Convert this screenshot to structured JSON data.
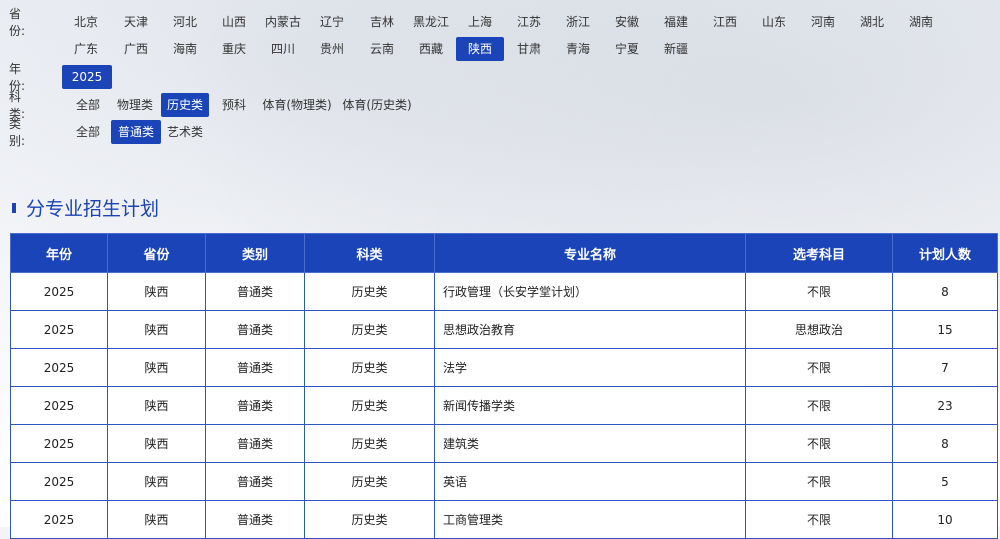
{
  "filters": {
    "province": {
      "label": "省份:",
      "row1": [
        "北京",
        "天津",
        "河北",
        "山西",
        "内蒙古",
        "辽宁",
        "吉林",
        "黑龙江",
        "上海",
        "江苏",
        "浙江",
        "安徽",
        "福建",
        "江西",
        "山东",
        "河南",
        "湖北",
        "湖南"
      ],
      "row2": [
        "广东",
        "广西",
        "海南",
        "重庆",
        "四川",
        "贵州",
        "云南",
        "西藏",
        "陕西",
        "甘肃",
        "青海",
        "宁夏",
        "新疆"
      ],
      "selected": "陕西"
    },
    "year": {
      "label": "年份:",
      "options": [
        "2025"
      ],
      "selected": "2025"
    },
    "subject": {
      "label": "科类:",
      "options": [
        "全部",
        "物理类",
        "历史类",
        "预科",
        "体育(物理类)",
        "体育(历史类)"
      ],
      "selected": "历史类"
    },
    "category": {
      "label": "类别:",
      "options": [
        "全部",
        "普通类",
        "艺术类"
      ],
      "selected": "普通类"
    }
  },
  "section": {
    "title": "分专业招生计划"
  },
  "table": {
    "headers": [
      "年份",
      "省份",
      "类别",
      "科类",
      "专业名称",
      "选考科目",
      "计划人数"
    ],
    "rows": [
      [
        "2025",
        "陕西",
        "普通类",
        "历史类",
        "行政管理（长安学堂计划）",
        "不限",
        "8"
      ],
      [
        "2025",
        "陕西",
        "普通类",
        "历史类",
        "思想政治教育",
        "思想政治",
        "15"
      ],
      [
        "2025",
        "陕西",
        "普通类",
        "历史类",
        "法学",
        "不限",
        "7"
      ],
      [
        "2025",
        "陕西",
        "普通类",
        "历史类",
        "新闻传播学类",
        "不限",
        "23"
      ],
      [
        "2025",
        "陕西",
        "普通类",
        "历史类",
        "建筑类",
        "不限",
        "8"
      ],
      [
        "2025",
        "陕西",
        "普通类",
        "历史类",
        "英语",
        "不限",
        "5"
      ],
      [
        "2025",
        "陕西",
        "普通类",
        "历史类",
        "工商管理类",
        "不限",
        "10"
      ]
    ]
  },
  "colors": {
    "accent": "#1a44b8",
    "border": "#2f55c4"
  }
}
